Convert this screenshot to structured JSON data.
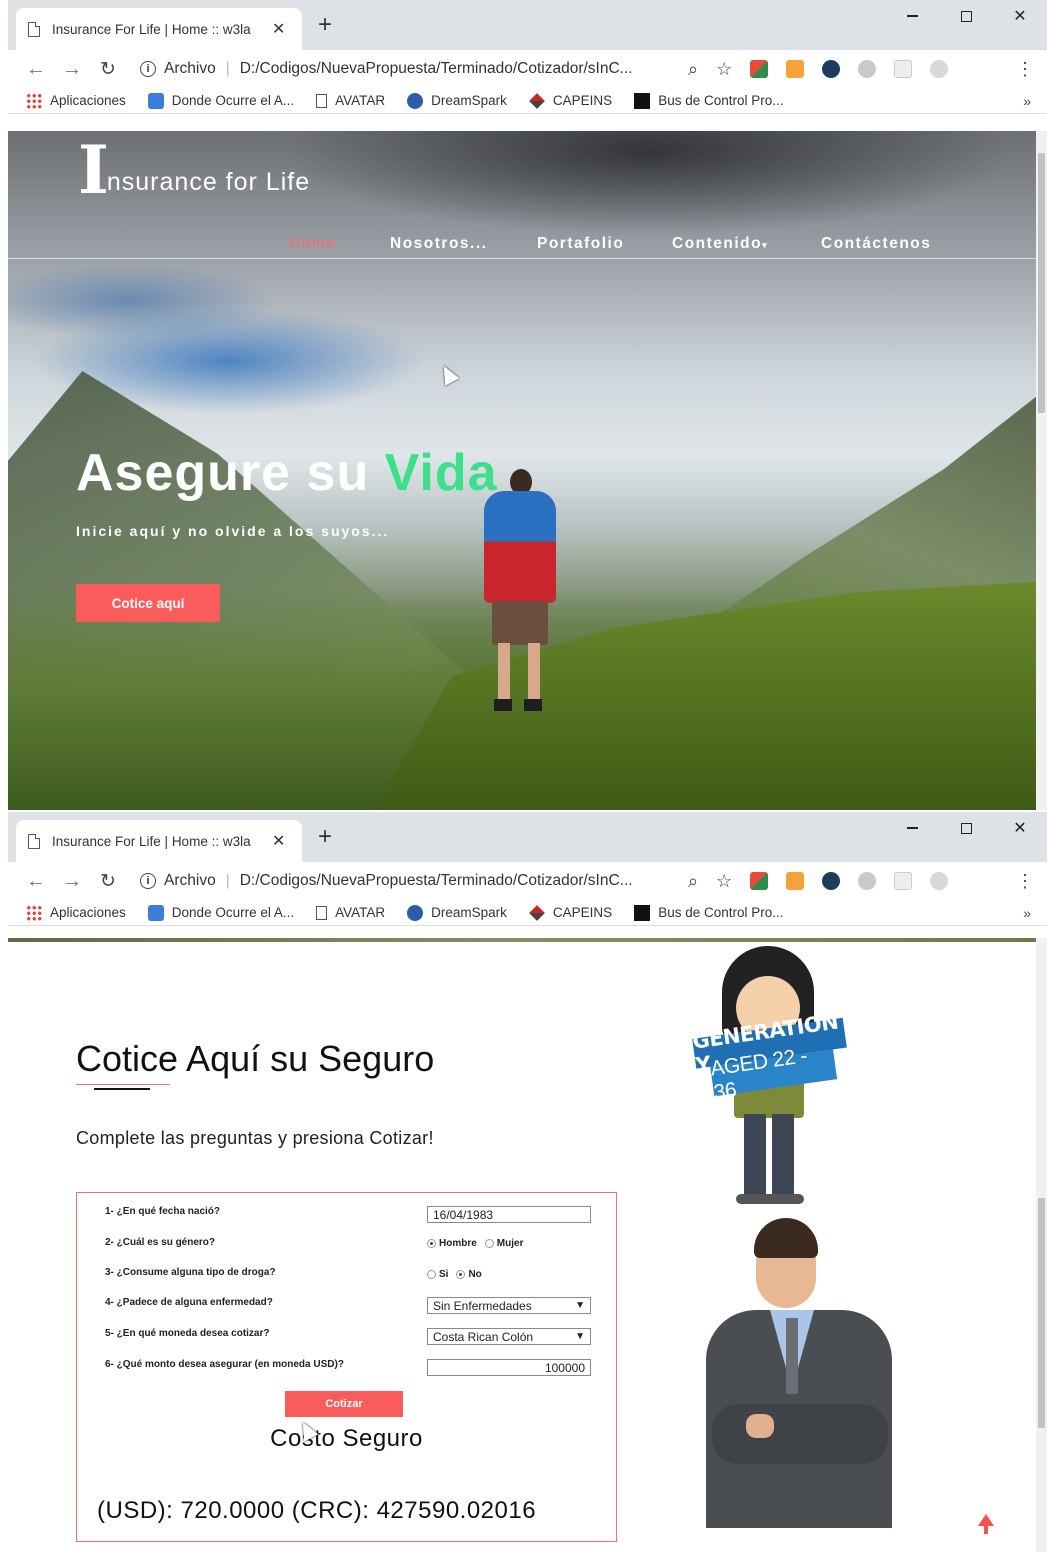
{
  "browser": {
    "tab_title": "Insurance For Life | Home :: w3la",
    "tab_close": "✕",
    "new_tab": "+",
    "address_label": "Archivo",
    "address_url": "D:/Codigos/NuevaPropuesta/Terminado/Cotizador/sInC...",
    "bookmarks": [
      "Aplicaciones",
      "Donde Ocurre el A...",
      "AVATAR",
      "DreamSpark",
      "CAPEINS",
      "Bus de Control Pro..."
    ],
    "bookmarks_more": "»"
  },
  "hero": {
    "brand_letter": "I",
    "brand_rest": "nsurance for Life",
    "nav": {
      "home": "Home",
      "about": "Nosotros...",
      "portfolio": "Portafolio",
      "content": "Contenido",
      "contact": "Contáctenos"
    },
    "title_main": "Asegure su ",
    "title_accent": "Vida",
    "subtitle": "Inicie aquí y no olvide a los suyos...",
    "cta": "Cotice aquí"
  },
  "form": {
    "title": "Cotice Aquí su Seguro",
    "subtitle": "Complete las preguntas y presiona Cotizar!",
    "questions": [
      "1- ¿En qué fecha nació?",
      "2- ¿Cuál es su género?",
      "3- ¿Consume alguna tipo de droga?",
      "4- ¿Padece de alguna enfermedad?",
      "5- ¿En qué moneda desea cotizar?",
      "6- ¿Qué monto desea asegurar (en moneda USD)?"
    ],
    "birth_date": "16/04/1983",
    "gender_options": [
      "Hombre",
      "Mujer"
    ],
    "gender_selected": "Hombre",
    "drug_options": [
      "Si",
      "No"
    ],
    "drug_selected": "No",
    "illness_value": "Sin Enfermedades",
    "currency_value": "Costa Rican Colón",
    "amount_value": "100000",
    "submit": "Cotizar",
    "cost_title": "Costo Seguro",
    "cost_result": "(USD): 720.0000 (CRC): 427590.02016"
  },
  "illustrations": {
    "banner_line1": "GENERATION Y",
    "banner_line2": "AGED 22 - 36"
  },
  "colors": {
    "accent_red": "#fa5c5c",
    "accent_green": "#3de08a",
    "active_nav": "#fa6a6a"
  }
}
